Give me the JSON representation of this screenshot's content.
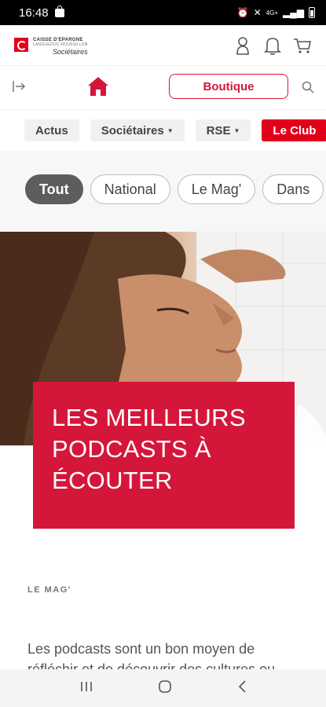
{
  "status_bar": {
    "time": "16:48",
    "network": "4G+"
  },
  "logo": {
    "line1": "CAISSE D'EPARGNE",
    "line2": "LANGUEDOC-ROUSSILLON",
    "line3": "Sociétaires"
  },
  "nav": {
    "boutique_label": "Boutique"
  },
  "menu": [
    {
      "label": "Actus",
      "dropdown": false,
      "active": false
    },
    {
      "label": "Sociétaires",
      "dropdown": true,
      "active": false
    },
    {
      "label": "RSE",
      "dropdown": true,
      "active": false
    },
    {
      "label": "Le Club",
      "dropdown": false,
      "active": true
    }
  ],
  "filters": [
    {
      "label": "Tout",
      "active": true
    },
    {
      "label": "National",
      "active": false
    },
    {
      "label": "Le Mag'",
      "active": false
    },
    {
      "label": "Dans",
      "active": false
    }
  ],
  "article": {
    "title_line1": "LES MEILLEURS",
    "title_line2": "PODCASTS À",
    "title_line3": "ÉCOUTER",
    "category": "LE MAG'",
    "excerpt": "Les podcasts sont un bon moyen de réfléchir et de découvrir des cultures ou"
  },
  "colors": {
    "brand_red": "#e2001a",
    "card_red": "#d5163b",
    "chip_active": "#5d5d5d"
  }
}
